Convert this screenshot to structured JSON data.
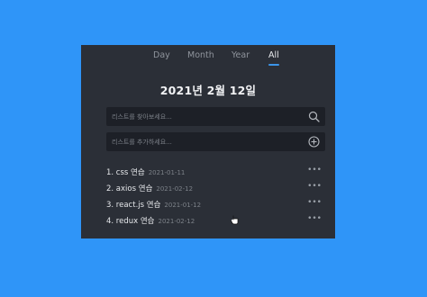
{
  "tabs": [
    {
      "label": "Day"
    },
    {
      "label": "Month"
    },
    {
      "label": "Year"
    },
    {
      "label": "All",
      "active": true
    }
  ],
  "date_title": "2021년 2월 12일",
  "search": {
    "placeholder": "리스트를 찾아보세요...",
    "icon": "search-icon"
  },
  "add": {
    "placeholder": "리스트를 추가하세요...",
    "icon": "plus-circle-icon"
  },
  "items": [
    {
      "label": "1. css 연습",
      "date": "2021-01-11",
      "more": "•••"
    },
    {
      "label": "2. axios 연습",
      "date": "2021-02-12",
      "more": "•••"
    },
    {
      "label": "3. react.js 연습",
      "date": "2021-01-12",
      "more": "•••"
    },
    {
      "label": "4. redux 연습",
      "date": "2021-02-12",
      "more": "•••"
    }
  ],
  "colors": {
    "background": "#2f95f8",
    "card": "#2b2f37",
    "accent": "#3b94e8"
  }
}
